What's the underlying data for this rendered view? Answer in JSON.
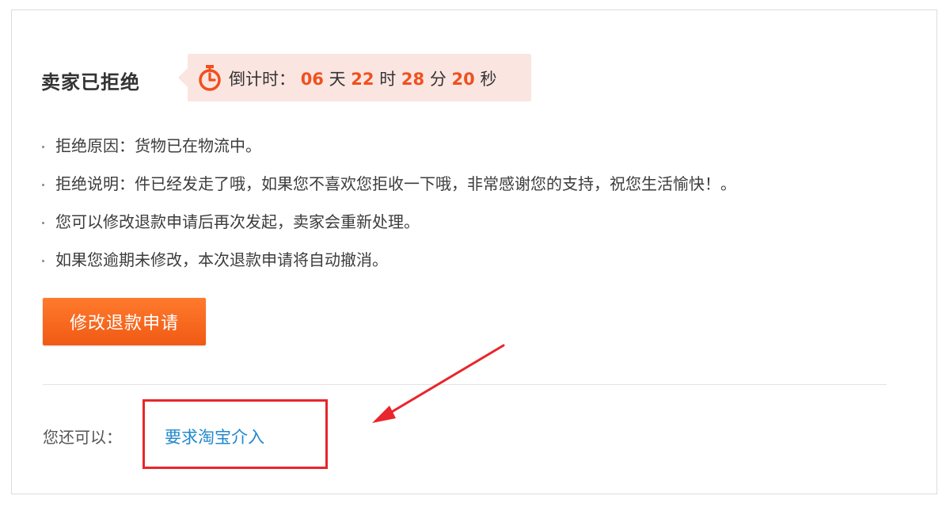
{
  "status": {
    "title": "卖家已拒绝",
    "countdown_label": "倒计时：",
    "days": "06",
    "days_unit": "天",
    "hours": "22",
    "hours_unit": "时",
    "minutes": "28",
    "minutes_unit": "分",
    "seconds": "20",
    "seconds_unit": "秒"
  },
  "notes": [
    "拒绝原因：货物已在物流中。",
    "拒绝说明：件已经发走了哦，如果您不喜欢您拒收一下哦，非常感谢您的支持，祝您生活愉快！。",
    "您可以修改退款申请后再次发起，卖家会重新处理。",
    "如果您逾期未修改，本次退款申请将自动撤消。"
  ],
  "actions": {
    "modify_button": "修改退款申请",
    "also_label": "您还可以：",
    "intervene_link": "要求淘宝介入"
  },
  "colors": {
    "accent": "#f05a14",
    "countdown_bg": "#fbe5e1",
    "number": "#f0501e",
    "link": "#2288cc",
    "annotation": "#e8262b"
  },
  "icons": {
    "timer": "stopwatch-icon",
    "annotation_arrow": "red-arrow-icon"
  }
}
